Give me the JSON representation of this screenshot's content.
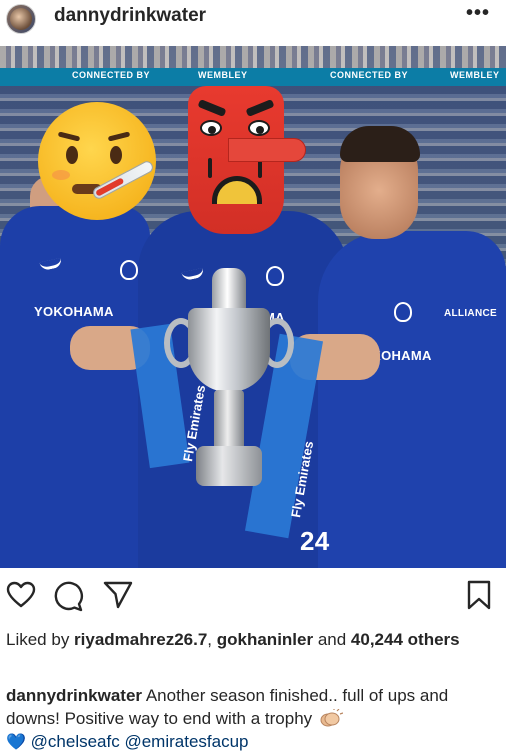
{
  "header": {
    "username": "dannydrinkwater",
    "more_icon": "more-options-icon",
    "more_glyph": "•••"
  },
  "photo": {
    "adboard": [
      "CONNECTED BY",
      "WEMBLEY",
      "CONNECTED BY",
      "WEMBLEY"
    ],
    "sponsors": {
      "left": "YOKOHAMA",
      "middle": "MA",
      "right": "YOKOHAMA",
      "right_sleeve": "ALLIANCE",
      "number": "24"
    },
    "ribbon_text": "Fly Emirates",
    "emoji": [
      "face-with-thermometer-emoji",
      "tengu-mask-emoji"
    ]
  },
  "actions": {
    "icons": [
      "heart-icon",
      "comment-icon",
      "share-icon",
      "bookmark-icon"
    ]
  },
  "likes": {
    "prefix": "Liked by ",
    "user1": "riyadmahrez26.7",
    "sep": ", ",
    "user2": "gokhaninler",
    "mid": " and ",
    "count": "40,244",
    "suffix": " others"
  },
  "caption": {
    "username": "dannydrinkwater",
    "text": " Another season finished.. full of ups and downs! Positive way to end with a trophy ",
    "emoji": "clapping-hands-icon",
    "heart_glyph": "💙",
    "mention1": "@chelseafc",
    "mention2": "@emiratesfacup"
  },
  "colors": {
    "text": "#262626",
    "kit_blue": "#1d3fa8",
    "mention": "#003569",
    "blue_heart": "#2e7bd3"
  }
}
